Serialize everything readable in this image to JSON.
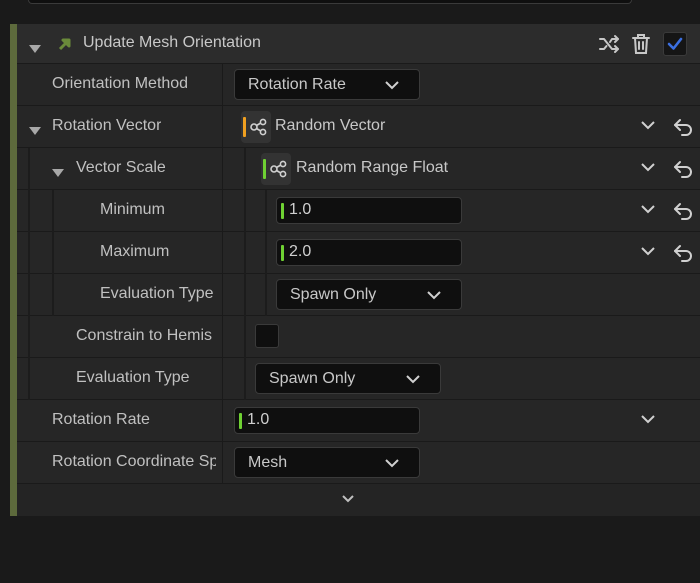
{
  "header": {
    "title": "Update Mesh Orientation",
    "enabled": true
  },
  "rows": {
    "orientation_method": {
      "label": "Orientation Method",
      "value": "Rotation Rate"
    },
    "rotation_vector": {
      "label": "Rotation Vector",
      "value": "Random Vector"
    },
    "vector_scale": {
      "label": "Vector Scale",
      "value": "Random Range Float"
    },
    "minimum": {
      "label": "Minimum",
      "value": "1.0"
    },
    "maximum": {
      "label": "Maximum",
      "value": "2.0"
    },
    "evaluation_type_inner": {
      "label": "Evaluation Type",
      "value": "Spawn Only"
    },
    "constrain": {
      "label": "Constrain to Hemis",
      "checked": false
    },
    "evaluation_type_outer": {
      "label": "Evaluation Type",
      "value": "Spawn Only"
    },
    "rotation_rate": {
      "label": "Rotation Rate",
      "value": "1.0"
    },
    "rotation_coordinate_space": {
      "label": "Rotation Coordinate Sp",
      "value": "Mesh"
    }
  },
  "colors": {
    "accent_green": "#6fd133",
    "accent_orange": "#f0a020",
    "checkbox_blue": "#3b6fe0",
    "panel_stripe": "#5d6a3c"
  },
  "icons": {
    "shuffle": "shuffle-icon",
    "delete": "trash-icon",
    "dynamic_input": "graph-node-icon",
    "reset": "reset-arrow-icon",
    "chevron": "chevron-down-icon"
  }
}
